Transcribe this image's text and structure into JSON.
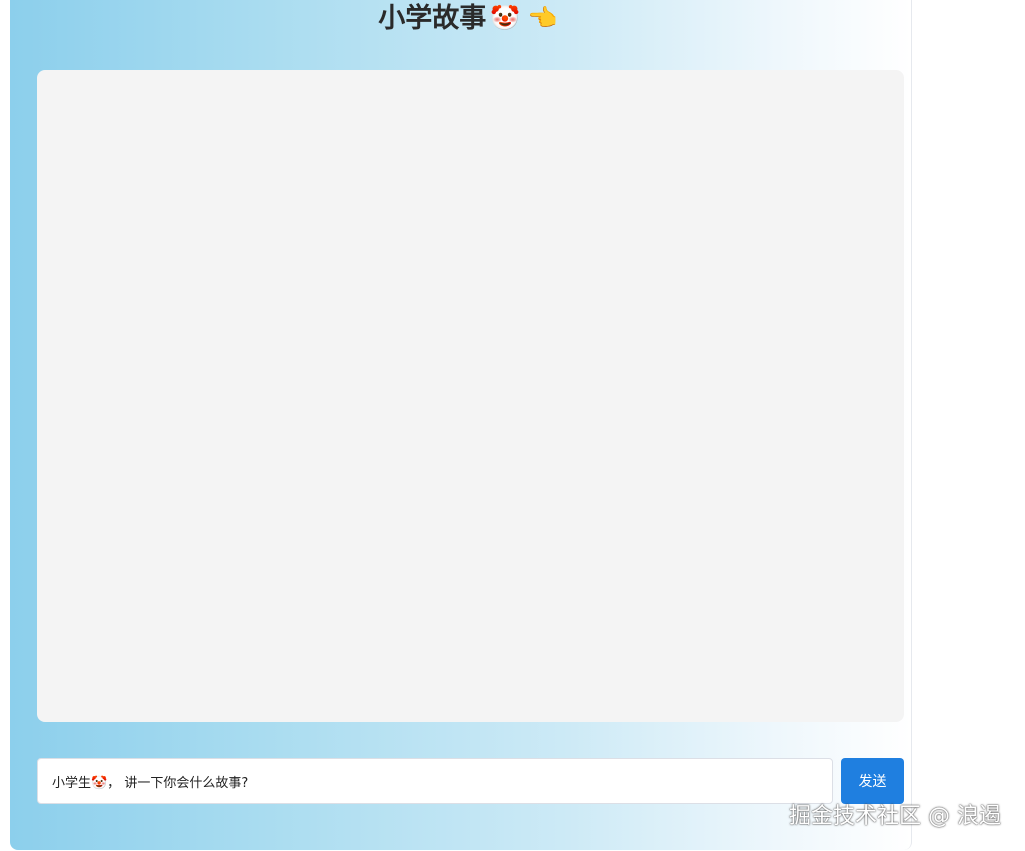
{
  "header": {
    "title": "小学故事",
    "title_emoji": "🤡 👈"
  },
  "composer": {
    "input_value": "小学生🤡， 讲一下你会什么故事?",
    "send_label": "发送"
  },
  "watermark": {
    "text": "掘金技术社区 @ 浪遏"
  },
  "colors": {
    "send_button": "#1f7fe0",
    "message_area": "#f4f4f4",
    "gradient_start": "#8ccfec",
    "gradient_end": "#ffffff"
  }
}
